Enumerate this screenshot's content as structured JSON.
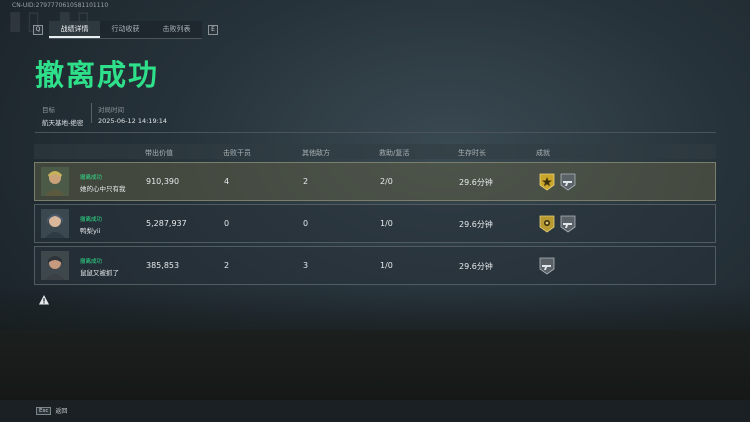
{
  "uid": "CN-UID:2797770610581101110",
  "tabs": {
    "left_key": "Q",
    "right_key": "E",
    "items": [
      "战绩详情",
      "行动收获",
      "击败列表"
    ],
    "active_index": 0
  },
  "title": "撤离成功",
  "info": {
    "target_label": "目标",
    "target_value": "航天基地-绝密",
    "time_label": "对局时间",
    "time_value": "2025-06-12 14:19:14"
  },
  "table": {
    "headers": [
      "带出价值",
      "击败干员",
      "其他敌方",
      "救助/复活",
      "生存时长",
      "成就"
    ],
    "rows": [
      {
        "status": "撤离成功",
        "name": "她的心中只有我",
        "value": "910,390",
        "kills": "4",
        "other": "2",
        "assist": "2/0",
        "time": "29.6分钟",
        "badges": [
          "gold-star-badge-icon",
          "silver-gun-badge-icon"
        ],
        "mvp": true
      },
      {
        "status": "撤离成功",
        "name": "鸭梨yii",
        "value": "5,287,937",
        "kills": "0",
        "other": "0",
        "assist": "1/0",
        "time": "29.6分钟",
        "badges": [
          "gold-sun-badge-icon",
          "silver-gun-badge-icon"
        ],
        "mvp": false
      },
      {
        "status": "撤离成功",
        "name": "鼠鼠又被抓了",
        "value": "385,853",
        "kills": "2",
        "other": "3",
        "assist": "1/0",
        "time": "29.6分钟",
        "badges": [
          "silver-gun-badge-icon"
        ],
        "mvp": false
      }
    ]
  },
  "footer": {
    "key": "Esc",
    "label": "返回"
  },
  "colors": {
    "accent_green": "#2fe08a",
    "gold": "#c9a52a"
  }
}
